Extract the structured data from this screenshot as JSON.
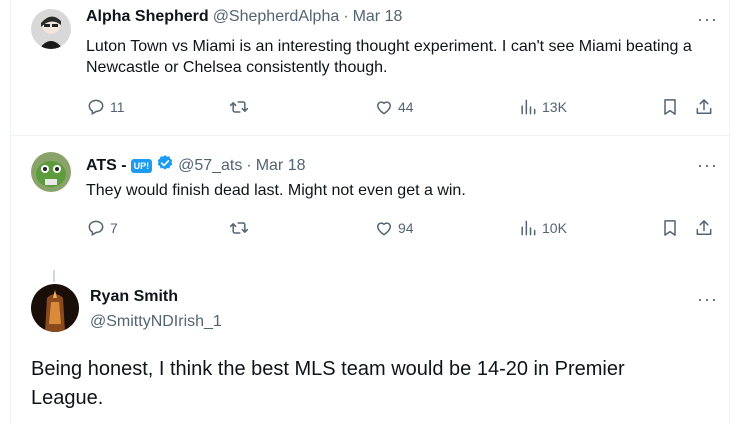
{
  "tweets": [
    {
      "name": "Alpha Shepherd",
      "handle": "@ShepherdAlpha",
      "separator": "·",
      "date": "Mar 18",
      "text": "Luton Town vs Miami is an interesting thought experiment. I can't see Miami beating a Newcastle or Chelsea consistently though.",
      "replies": "11",
      "reposts": "",
      "likes": "44",
      "views": "13K"
    },
    {
      "name": "ATS -",
      "badge": "UP!",
      "handle": "@57_ats",
      "separator": "·",
      "date": "Mar 18",
      "text": "They would finish dead last.  Might not even get a win.",
      "replies": "7",
      "reposts": "",
      "likes": "94",
      "views": "10K"
    }
  ],
  "focused": {
    "name": "Ryan Smith",
    "handle": "@SmittyNDIrish_1",
    "text": "Being honest, I think the best MLS team would be 14-20 in Premier League."
  },
  "more_label": "···",
  "icons": {
    "reply": "reply-icon",
    "repost": "repost-icon",
    "like": "heart-icon",
    "views": "views-icon",
    "bookmark": "bookmark-icon",
    "share": "share-icon",
    "verified": "verified-badge-icon"
  },
  "colors": {
    "accent": "#1d9bf0",
    "muted": "#536471",
    "border": "#eff3f4"
  }
}
